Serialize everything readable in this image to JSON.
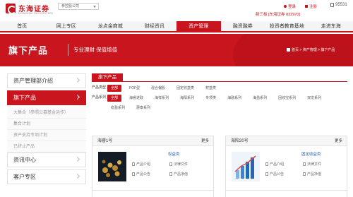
{
  "header": {
    "logo_cn": "东海证券",
    "logo_en": "DONGHAI SECURITIES",
    "company_select": "参控股公司",
    "login": "登录",
    "register": "注册",
    "phone": "95531",
    "stock_ticker": "新三板 [东海证券 832970]"
  },
  "nav": {
    "items": [
      {
        "label": "首页",
        "active": false
      },
      {
        "label": "网上专区",
        "active": false
      },
      {
        "label": "龙点金商城",
        "active": false
      },
      {
        "label": "财经资讯",
        "active": false
      },
      {
        "label": "资产管理",
        "active": true
      },
      {
        "label": "融资融券",
        "active": false
      },
      {
        "label": "投资者教育基地",
        "active": false
      },
      {
        "label": "走进东海",
        "active": false
      }
    ]
  },
  "banner": {
    "title": "旗下产品",
    "subtitle": "专业理财 保值增值",
    "breadcrumb": "首页 > 资产管理 > 旗下产品"
  },
  "sidebar": {
    "items": [
      {
        "label": "资产管理部介绍",
        "active": false
      },
      {
        "label": "旗下产品",
        "active": true
      }
    ],
    "subitems": [
      "大集合（参照公募基金运作）",
      "集合计划",
      "资产支持专项计划",
      "已终止产品"
    ],
    "items_after": [
      {
        "label": "资讯中心"
      },
      {
        "label": "客户专区"
      }
    ]
  },
  "main": {
    "section_tab": "旗下产品",
    "filter_type": {
      "label": "产品类型",
      "options": [
        "全部",
        "FOF型",
        "混合偏股",
        "固定收益类",
        "权益类"
      ],
      "selected": "全部"
    },
    "filter_series": {
      "label": "产品系列",
      "options": [
        "全部",
        "海睿进取",
        "海祥系列",
        "海阳系列",
        "专项类",
        "海融系列",
        "海盈系列",
        "固收宝系列",
        "双龙系列",
        "稳盈系列",
        "惠泰系列"
      ],
      "selected": "全部"
    },
    "cards": [
      {
        "name": "海睿1号",
        "more": "更多",
        "type": "权益类",
        "docs": [
          "产品介绍",
          "法律文件",
          "产品公告",
          "产品净值"
        ]
      },
      {
        "name": "海阳20号",
        "more": "更多",
        "type": "固定收益类",
        "docs": [
          "产品介绍",
          "法律文件",
          "产品公告",
          "产品净值"
        ]
      }
    ]
  },
  "colors": {
    "brand_red": "#c9151e",
    "link_blue": "#2a62b6"
  }
}
